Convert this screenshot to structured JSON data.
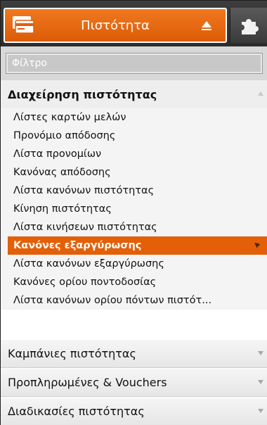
{
  "header": {
    "title": "Πιστότητα",
    "tab_icon": "credit-card-icon",
    "collapse_icon": "eject-collapse-icon",
    "plugin_icon": "puzzle-piece-icon",
    "accent_color": "#e35f08"
  },
  "filter": {
    "placeholder": "Φίλτρο",
    "value": ""
  },
  "sections": [
    {
      "label": "Διαχείρηση πιστότητας",
      "expanded": true,
      "items": [
        "Λίστες καρτών μελών",
        "Προνόμιο απόδοσης",
        "Λίστα προνομίων",
        "Κανόνας απόδοσης",
        "Λίστα κανόνων πιστότητας",
        "Κίνηση πιστότητας",
        "Λίστα κινήσεων πιστότητας",
        "Κανόνες εξαργύρωσης",
        "Λίστα κανόνων εξαργύρωσης",
        "Κανόνες ορίου ποντοδοσίας",
        "Λίστα κανόνων ορίου πόντων πιστότ..."
      ],
      "active_index": 7
    },
    {
      "label": "Καμπάνιες πιστότητας",
      "expanded": false
    },
    {
      "label": "Προπληρωμένες & Vouchers",
      "expanded": false
    },
    {
      "label": "Διαδικασίες πιστότητας",
      "expanded": false
    }
  ]
}
